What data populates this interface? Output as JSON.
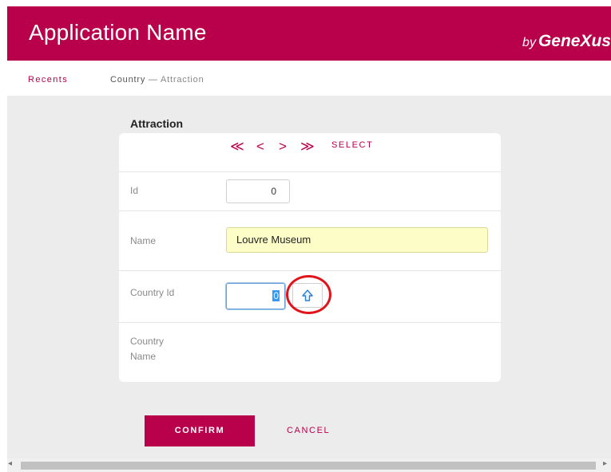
{
  "header": {
    "title": "Application Name",
    "brand_by": "by",
    "brand_name": "GeneXus"
  },
  "breadcrumb": {
    "recents": "Recents",
    "current": "Country",
    "separator": "—",
    "current_sub": "Attraction"
  },
  "form": {
    "title": "Attraction",
    "nav": {
      "first": "≪",
      "previous": "<",
      "next": ">",
      "last": "≫",
      "select": "SELECT"
    },
    "fields": {
      "id": {
        "label": "Id",
        "value": "0"
      },
      "name": {
        "label": "Name",
        "value": "Louvre Museum"
      },
      "country_id": {
        "label": "Country Id",
        "value": "0"
      },
      "country_name": {
        "label_line1": "Country",
        "label_line2": "Name",
        "value": ""
      }
    },
    "prompt_icon": "up-arrow-icon"
  },
  "actions": {
    "confirm": "CONFIRM",
    "cancel": "CANCEL"
  },
  "colors": {
    "accent": "#b8004b",
    "highlight_field": "#fdfdc8",
    "annotation": "#e0151b"
  }
}
